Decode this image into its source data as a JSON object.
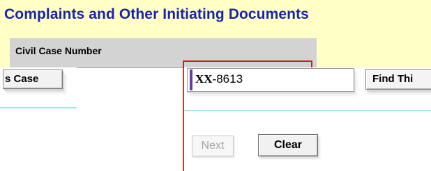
{
  "header": {
    "title": "Complaints and Other Initiating Documents",
    "field_label": "Civil Case Number"
  },
  "left_zoom": {
    "button_label": "s Case"
  },
  "right_zoom": {
    "case_number_prefix": "XX-",
    "case_number_digits": "8613",
    "find_button_label": "Find Thi"
  },
  "actions": {
    "next_label": "Next",
    "clear_label": "Clear"
  },
  "colors": {
    "banner_bg": "#ffffc6",
    "title_text": "#1a22b0",
    "highlight_red": "#b52a20",
    "focus_bar": "#6a3aa0"
  }
}
